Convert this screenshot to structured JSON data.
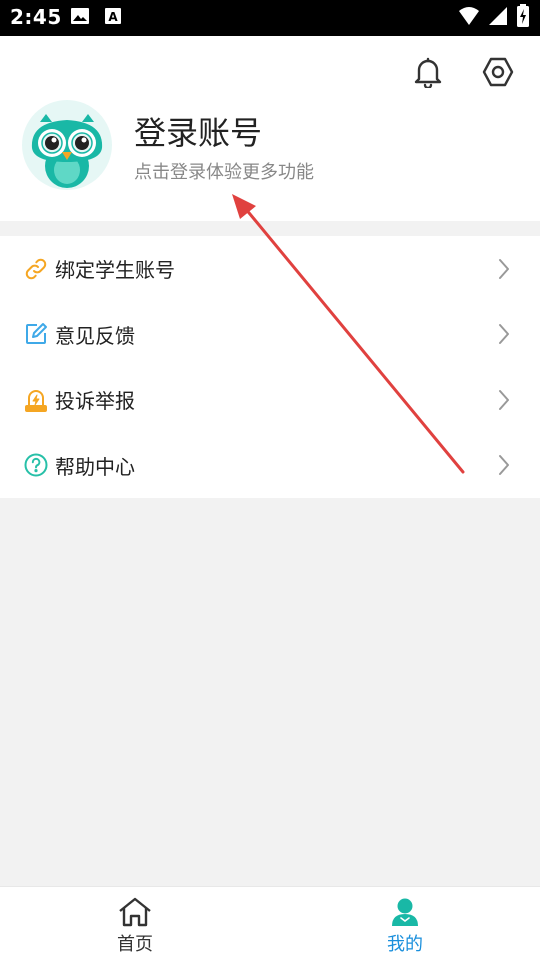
{
  "status_bar": {
    "time": "2:45",
    "left_icons": [
      "image-icon",
      "text-notification-icon"
    ],
    "right_icons": [
      "wifi-icon",
      "signal-icon",
      "battery-charging-icon"
    ]
  },
  "header": {
    "icons": [
      "bell-icon",
      "settings-hexagon-icon"
    ]
  },
  "profile": {
    "avatar_icon": "owl-avatar-icon",
    "title": "登录账号",
    "subtitle": "点击登录体验更多功能"
  },
  "menu": {
    "items": [
      {
        "label": "绑定学生账号",
        "icon": "link-icon",
        "icon_color": "#f5a623"
      },
      {
        "label": "意见反馈",
        "icon": "edit-icon",
        "icon_color": "#3fa9e8"
      },
      {
        "label": "投诉举报",
        "icon": "report-icon",
        "icon_color": "#f5a623"
      },
      {
        "label": "帮助中心",
        "icon": "help-icon",
        "icon_color": "#27c0a8"
      }
    ]
  },
  "bottom_nav": {
    "items": [
      {
        "label": "首页",
        "icon": "home-icon",
        "active": false
      },
      {
        "label": "我的",
        "icon": "person-icon",
        "active": true
      }
    ]
  },
  "colors": {
    "accent": "#1a8fdc",
    "teal": "#19b8a6",
    "annotation": "#e0413f"
  }
}
